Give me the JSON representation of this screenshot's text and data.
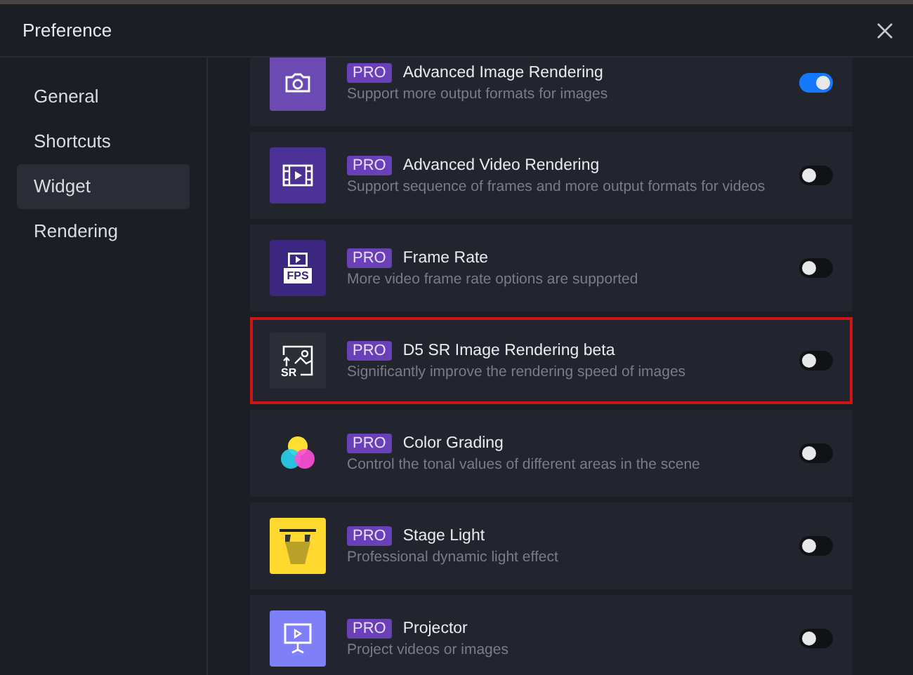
{
  "window": {
    "title": "Preference"
  },
  "sidebar": {
    "items": [
      {
        "label": "General",
        "selected": false
      },
      {
        "label": "Shortcuts",
        "selected": false
      },
      {
        "label": "Widget",
        "selected": true
      },
      {
        "label": "Rendering",
        "selected": false
      }
    ]
  },
  "widgets": [
    {
      "kind": "camera",
      "badge": "PRO",
      "title": "Advanced Image Rendering",
      "description": "Support more output formats for images",
      "on": true,
      "highlighted": false
    },
    {
      "kind": "video",
      "badge": "PRO",
      "title": "Advanced Video Rendering",
      "description": "Support sequence of frames and more output formats for videos",
      "on": false,
      "highlighted": false
    },
    {
      "kind": "fps",
      "icon_label": "FPS",
      "badge": "PRO",
      "title": "Frame Rate",
      "description": "More video frame rate options are supported",
      "on": false,
      "highlighted": false
    },
    {
      "kind": "sr",
      "icon_label": "SR",
      "badge": "PRO",
      "title": "D5 SR Image Rendering beta",
      "description": "Significantly improve the rendering speed of images",
      "on": false,
      "highlighted": true
    },
    {
      "kind": "color",
      "badge": "PRO",
      "title": "Color Grading",
      "description": "Control the tonal values of different areas in the scene",
      "on": false,
      "highlighted": false
    },
    {
      "kind": "stage",
      "badge": "PRO",
      "title": "Stage Light",
      "description": "Professional dynamic light effect",
      "on": false,
      "highlighted": false
    },
    {
      "kind": "projector",
      "badge": "PRO",
      "title": "Projector",
      "description": "Project videos or images",
      "on": false,
      "highlighted": false
    }
  ]
}
